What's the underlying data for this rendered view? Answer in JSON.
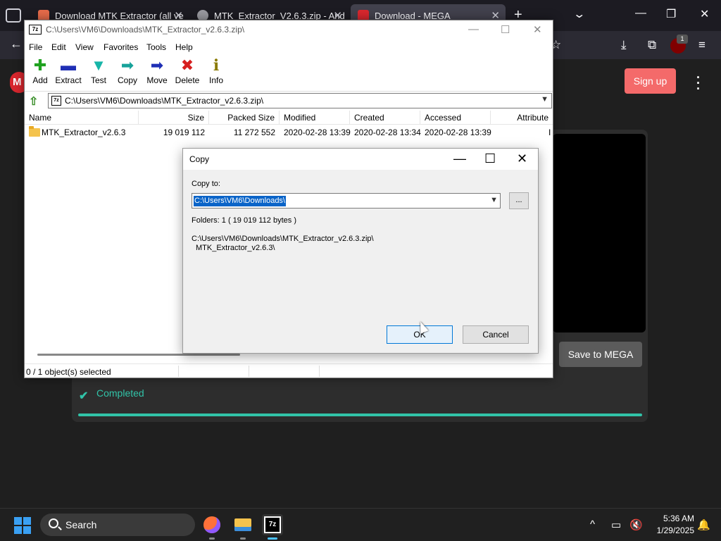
{
  "browser": {
    "tabs": [
      {
        "title": "Download MTK Extractor (all ve",
        "favicon_color": "#e66b4a"
      },
      {
        "title": "MTK_Extractor_V2.6.3.zip - And",
        "favicon_color": "#9a9aa0"
      },
      {
        "title": "Download - MEGA",
        "favicon_color": "#d9272e"
      }
    ],
    "new_tab": "+",
    "tabs_menu": "⌄",
    "window_controls": [
      "—",
      "❐",
      "✕"
    ],
    "toolbar": {
      "back": "←",
      "bookmark": "☆",
      "download": "⤓",
      "extensions": "⧉",
      "ublock_count": "1",
      "menu": "≡"
    }
  },
  "mega": {
    "logo_letter": "M",
    "signup_label": "Sign up",
    "save_label": "Save to MEGA",
    "status_label": "Completed",
    "progress": 1.0,
    "accent": "#31c3a8"
  },
  "zip": {
    "title": "C:\\Users\\VM6\\Downloads\\MTK_Extractor_v2.6.3.zip\\",
    "app_icon": "7z",
    "window_controls": [
      "—",
      "☐",
      "✕"
    ],
    "menu": [
      "File",
      "Edit",
      "View",
      "Favorites",
      "Tools",
      "Help"
    ],
    "tools": [
      {
        "label": "Add",
        "glyph": "✚",
        "color": "#1fa21f"
      },
      {
        "label": "Extract",
        "glyph": "▬",
        "color": "#1f2fb5"
      },
      {
        "label": "Test",
        "glyph": "▼",
        "color": "#17b5a8"
      },
      {
        "label": "Copy",
        "glyph": "➡",
        "color": "#17a29a"
      },
      {
        "label": "Move",
        "glyph": "➡",
        "color": "#1f2fb5"
      },
      {
        "label": "Delete",
        "glyph": "✖",
        "color": "#d61f1f"
      },
      {
        "label": "Info",
        "glyph": "ℹ",
        "color": "#8a7a00"
      }
    ],
    "address": "C:\\Users\\VM6\\Downloads\\MTK_Extractor_v2.6.3.zip\\",
    "columns": [
      "Name",
      "Size",
      "Packed Size",
      "Modified",
      "Created",
      "Accessed",
      "Attribute"
    ],
    "rows": [
      {
        "name": "MTK_Extractor_v2.6.3",
        "size": "19 019 112",
        "packed": "11 272 552",
        "modified": "2020-02-28 13:39",
        "created": "2020-02-28 13:34",
        "accessed": "2020-02-28 13:39",
        "attributes": "I"
      }
    ],
    "status": "0 / 1 object(s) selected"
  },
  "copy_dialog": {
    "title": "Copy",
    "window_controls": [
      "—",
      "☐",
      "✕"
    ],
    "copy_to_label": "Copy to:",
    "destination": "C:\\Users\\VM6\\Downloads\\",
    "browse_label": "...",
    "folders_info": "Folders: 1    ( 19 019 112 bytes )",
    "source_line1": "C:\\Users\\VM6\\Downloads\\MTK_Extractor_v2.6.3.zip\\",
    "source_line2": "MTK_Extractor_v2.6.3\\",
    "ok_label": "OK",
    "cancel_label": "Cancel"
  },
  "taskbar": {
    "search_placeholder": "Search",
    "apps": [
      "firefox",
      "file-explorer",
      "7-zip"
    ],
    "zip_label": "7z",
    "tray": {
      "chevron": "^",
      "time": "5:36 AM",
      "date": "1/29/2025"
    }
  }
}
